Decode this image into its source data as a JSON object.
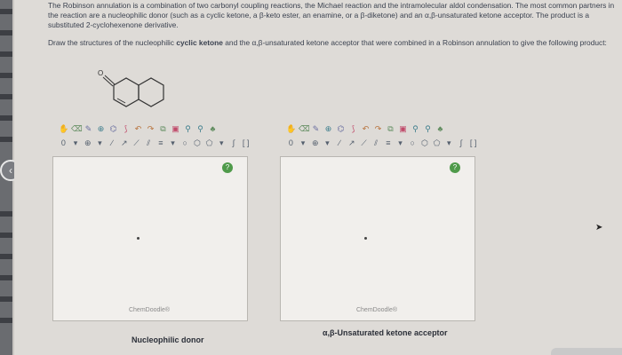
{
  "question": {
    "paragraph1": "The Robinson annulation is a combination of two carbonyl coupling reactions, the Michael reaction and the intramolecular aldol condensation. The most common partners in the reaction are a nucleophilic donor (such as a cyclic ketone, a β-keto ester, an enamine, or a β-diketone) and an α,β-unsaturated ketone acceptor. The product is a substituted 2-cyclohexenone derivative.",
    "paragraph2_start": "Draw the structures of the nucleophilic ",
    "paragraph2_bold": "cyclic ketone",
    "paragraph2_end": " and the α,β-unsaturated ketone acceptor that were combined in a Robinson annulation to give the following product:"
  },
  "product_structure": {
    "atom_label": "O"
  },
  "editors": [
    {
      "help_label": "?",
      "watermark": "ChemDoodle®",
      "caption": "Nucleophilic donor"
    },
    {
      "help_label": "?",
      "watermark": "ChemDoodle®",
      "caption": "α,β-Unsaturated ketone acceptor"
    }
  ],
  "sidebar": {
    "collapse_label": "‹"
  },
  "toolbar": {
    "row1": [
      "hand-icon",
      "eraser-icon",
      "pencil-icon",
      "zoom-in-icon",
      "template-icon",
      "lasso-icon",
      "undo-icon",
      "redo-icon",
      "copy-icon",
      "paste-icon",
      "zoom-icon",
      "zoom-out-icon",
      "clean-icon"
    ],
    "row2_charge": "0",
    "row2_glyphs": [
      "▾",
      "⊕",
      "▾",
      "∕",
      "↗",
      "∕",
      "∕",
      "∕",
      "▾",
      "○",
      "⬡",
      "⬠",
      "▾",
      "∫",
      "ₙ",
      "[ ]",
      "ⁿ"
    ]
  }
}
